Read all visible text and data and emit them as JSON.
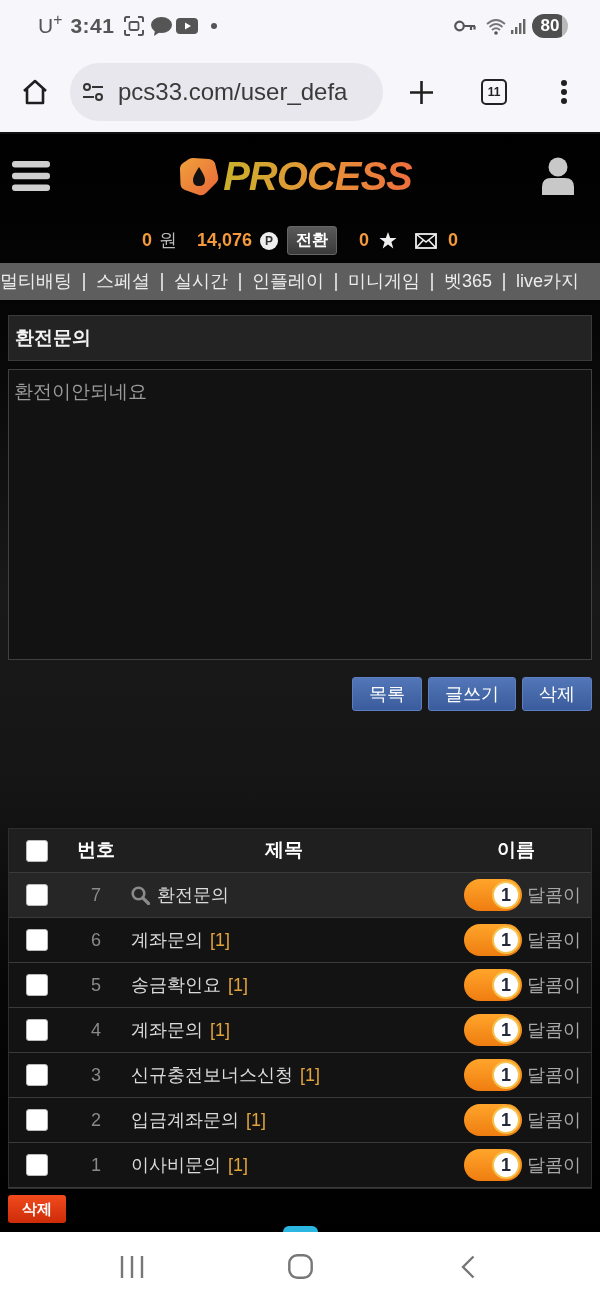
{
  "status_bar": {
    "carrier": "U$^{+}$",
    "time": "3:41",
    "battery": "80"
  },
  "browser": {
    "url": "pcs33.com/user_defa",
    "tab_count": "11"
  },
  "header": {
    "logo": "PROCESS"
  },
  "balance": {
    "cash": "0",
    "cash_unit": "원",
    "points": "14,076",
    "point_symbol": "P",
    "convert_button": "전환",
    "star_count": "0",
    "message_count": "0"
  },
  "nav_items": [
    "멀티배팅",
    "스페셜",
    "실시간",
    "인플레이",
    "미니게임",
    "벳365",
    "live카지"
  ],
  "post": {
    "title": "환전문의",
    "body": "환전이안되네요"
  },
  "post_buttons": [
    "목록",
    "글쓰기",
    "삭제"
  ],
  "board": {
    "select_all_checked": false,
    "columns": [
      "번호",
      "제목",
      "이름"
    ],
    "rows": [
      {
        "checked": false,
        "selected": true,
        "number": "7",
        "title": "환전문의",
        "rank": "1",
        "author": "달콤이"
      },
      {
        "checked": false,
        "selected": false,
        "number": "6",
        "title": "계좌문의",
        "comments": "[1]",
        "rank": "1",
        "author": "달콤이"
      },
      {
        "checked": false,
        "selected": false,
        "number": "5",
        "title": "송금확인요",
        "comments": "[1]",
        "rank": "1",
        "author": "달콤이"
      },
      {
        "checked": false,
        "selected": false,
        "number": "4",
        "title": "계좌문의",
        "comments": "[1]",
        "rank": "1",
        "author": "달콤이"
      },
      {
        "checked": false,
        "selected": false,
        "number": "3",
        "title": "신규충전보너스신청",
        "comments": "[1]",
        "rank": "1",
        "author": "달콤이"
      },
      {
        "checked": false,
        "selected": false,
        "number": "2",
        "title": "입금계좌문의",
        "comments": "[1]",
        "rank": "1",
        "author": "달콤이"
      },
      {
        "checked": false,
        "selected": false,
        "number": "1",
        "title": "이사비문의",
        "comments": "[1]",
        "rank": "1",
        "author": "달콤이"
      }
    ]
  },
  "delete_button": "삭제"
}
